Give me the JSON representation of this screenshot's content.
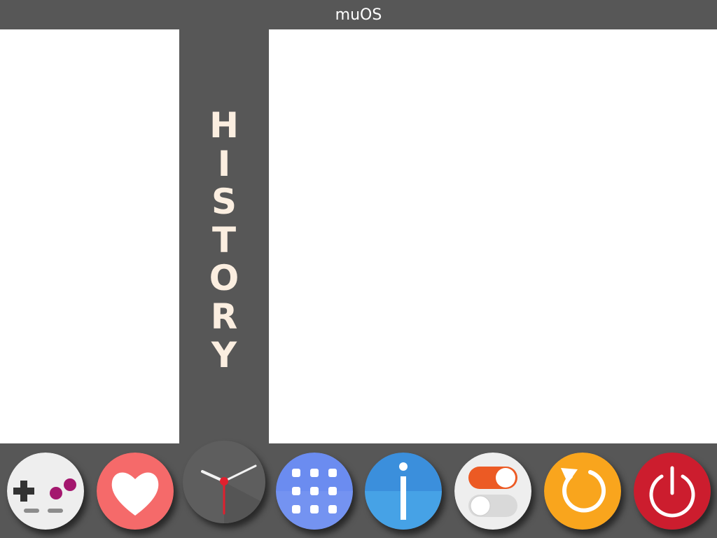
{
  "header": {
    "title": "muOS"
  },
  "sidebar": {
    "label": "HISTORY"
  },
  "dock": {
    "items": [
      {
        "name": "explore",
        "icon": "gamepad-icon",
        "color": "#eeeeee"
      },
      {
        "name": "favourites",
        "icon": "heart-icon",
        "color": "#f56a6a"
      },
      {
        "name": "history",
        "icon": "clock-icon",
        "color": "#5e5e5e",
        "selected": true
      },
      {
        "name": "apps",
        "icon": "grid-icon",
        "color": "#6b8cf0"
      },
      {
        "name": "info",
        "icon": "info-icon",
        "color": "#3b8fdc"
      },
      {
        "name": "config",
        "icon": "toggle-icon",
        "color": "#eeeeee"
      },
      {
        "name": "reboot",
        "icon": "refresh-icon",
        "color": "#f9a51d"
      },
      {
        "name": "shutdown",
        "icon": "power-icon",
        "color": "#cc1d2e"
      }
    ]
  }
}
